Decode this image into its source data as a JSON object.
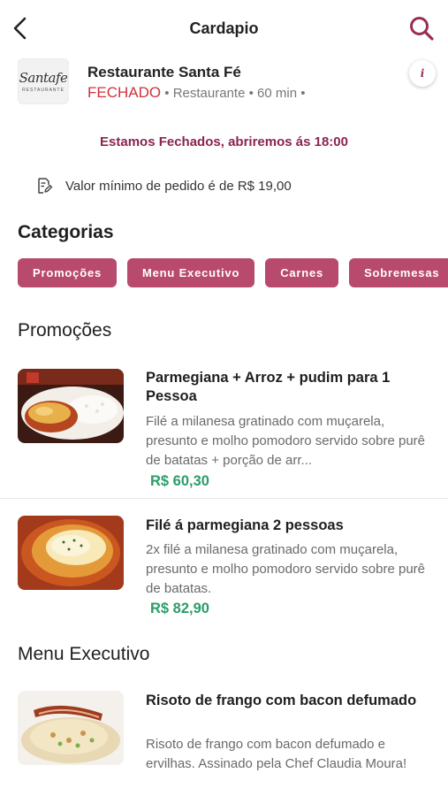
{
  "header": {
    "title": "Cardapio"
  },
  "restaurant": {
    "logo_text": "Santafe",
    "logo_subtext": "RESTAURANTE",
    "name": "Restaurante Santa Fé",
    "status": "FECHADO",
    "meta": " • Restaurante • 60 min •",
    "info_label": "i"
  },
  "closed_banner": "Estamos Fechados, abriremos ás 18:00",
  "min_order": "Valor mínimo de pedido é de R$ 19,00",
  "categories": {
    "title": "Categorias",
    "chips": [
      "Promoções",
      "Menu Executivo",
      "Carnes",
      "Sobremesas"
    ]
  },
  "sections": {
    "promocoes": "Promoções",
    "menu_executivo": "Menu Executivo"
  },
  "products": [
    {
      "name": "Parmegiana + Arroz + pudim para 1 Pessoa",
      "description": "Filé a milanesa gratinado com muçarela, presunto e molho pomodoro servido sobre purê de batatas + porção de arr...",
      "price": "R$ 60,30"
    },
    {
      "name": "Filé á parmegiana 2 pessoas",
      "description": "2x filé a milanesa gratinado com muçarela, presunto e molho pomodoro servido sobre purê de batatas.",
      "price": "R$ 82,90"
    },
    {
      "name": "Risoto de frango com bacon defumado",
      "description": "Risoto de frango com bacon defumado e ervilhas. Assinado pela Chef Claudia Moura!"
    }
  ],
  "colors": {
    "accent": "#9b2c55",
    "chip": "#b84a6e",
    "closed_status": "#d0323a",
    "price": "#2a9d6a"
  },
  "icons": {
    "back": "chevron-left-icon",
    "search": "search-icon",
    "info": "info-icon",
    "min_order": "document-edit-icon"
  }
}
